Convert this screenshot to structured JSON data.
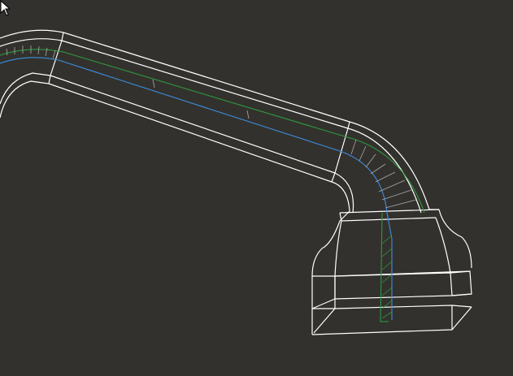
{
  "viewport": {
    "background": "#33312d",
    "wireframe_color": "#ffffff",
    "guide_green": "#2e9a3e",
    "guide_blue": "#3a8fe0",
    "hatch_color": "#a9a9a9"
  },
  "cursor": {
    "icon": "arrow-cursor-icon"
  }
}
